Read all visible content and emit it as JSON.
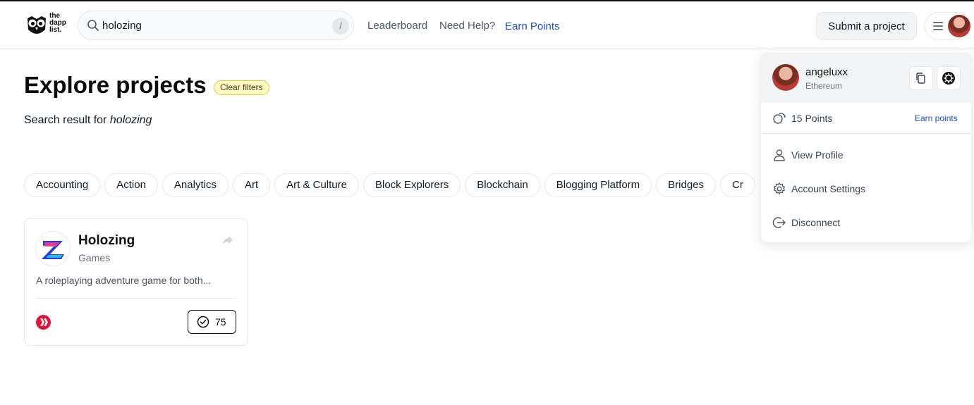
{
  "header": {
    "logo_text_lines": [
      "the",
      "dapp",
      "list."
    ],
    "search": {
      "value": "holozing",
      "shortcut": "/"
    },
    "nav": [
      {
        "label": "Leaderboard"
      },
      {
        "label": "Need Help?"
      },
      {
        "label": "Earn Points"
      }
    ],
    "submit_label": "Submit a project"
  },
  "main": {
    "title": "Explore projects",
    "clear_filters": "Clear filters",
    "search_result_prefix": "Search result for",
    "search_result_term": "holozing",
    "categories": [
      "Accounting",
      "Action",
      "Analytics",
      "Art",
      "Art & Culture",
      "Block Explorers",
      "Blockchain",
      "Blogging Platform",
      "Bridges",
      "Cr"
    ],
    "project": {
      "name": "Holozing",
      "category": "Games",
      "description": "A roleplaying adventure game for both...",
      "votes": "75"
    }
  },
  "dropdown": {
    "username": "angeluxx",
    "chain": "Ethereum",
    "points": "15 Points",
    "earn_points": "Earn points",
    "items": [
      {
        "label": "View Profile"
      },
      {
        "label": "Account Settings"
      },
      {
        "label": "Disconnect"
      }
    ]
  },
  "colors": {
    "accent": "#1d4ed8",
    "badge_bg": "#fef9c3",
    "badge_border": "#f1c232",
    "hive_red": "#e31337"
  }
}
